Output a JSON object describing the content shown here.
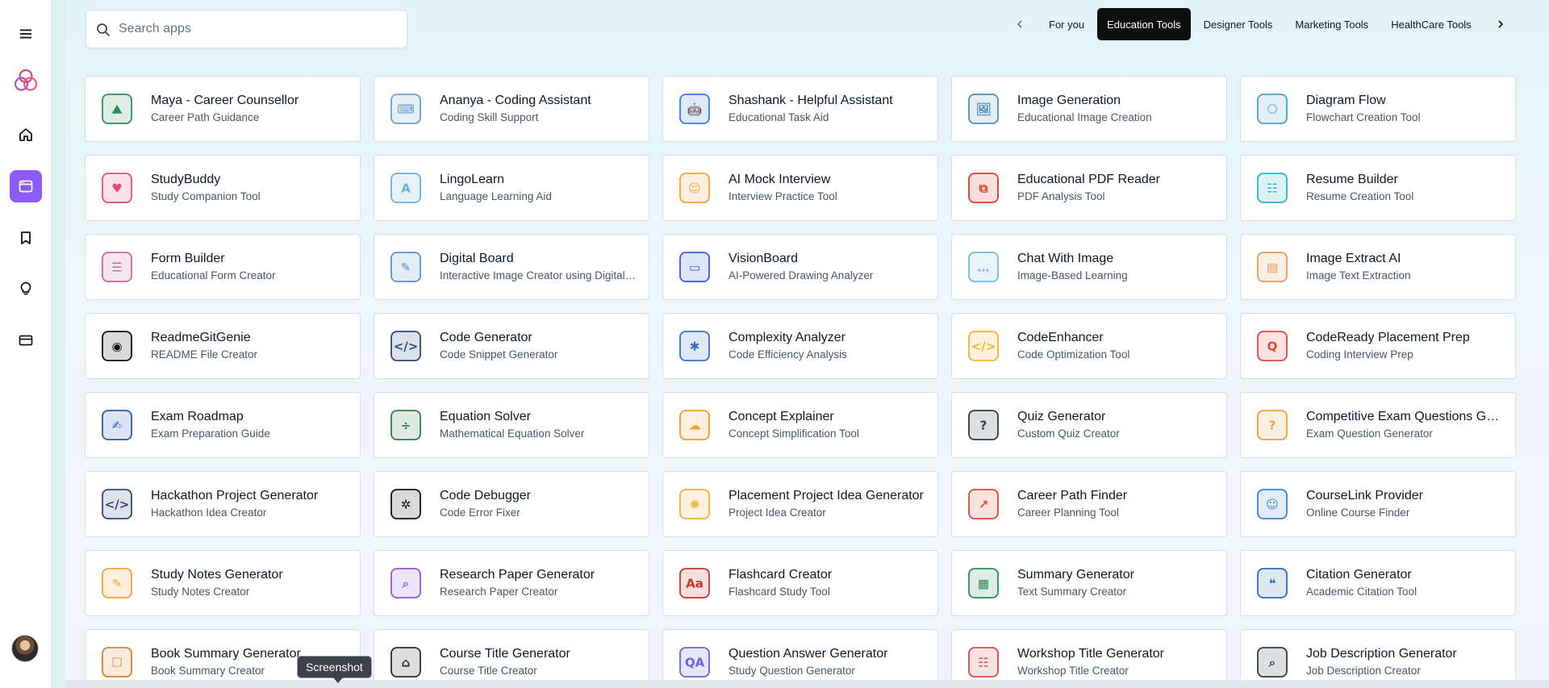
{
  "colors": {
    "accent": "#8b5cf6",
    "tab_active_bg": "#0f0f10",
    "card_border": "#d7dde3"
  },
  "sidebar": {
    "items": [
      {
        "icon": "menu-icon"
      },
      {
        "icon": "logo-icon"
      },
      {
        "icon": "home-icon"
      },
      {
        "icon": "apps-icon",
        "active": true
      },
      {
        "icon": "bookmark-icon"
      },
      {
        "icon": "lightbulb-icon"
      },
      {
        "icon": "billing-card-icon"
      }
    ],
    "avatar": "user-avatar"
  },
  "search": {
    "placeholder": "Search apps",
    "value": ""
  },
  "tabs": {
    "items": [
      {
        "label": "For you"
      },
      {
        "label": "Education Tools",
        "active": true
      },
      {
        "label": "Designer Tools"
      },
      {
        "label": "Marketing Tools"
      },
      {
        "label": "HealthCare Tools"
      }
    ]
  },
  "apps": [
    {
      "title": "Maya - Career Counsellor",
      "subtitle": "Career Path Guidance",
      "icon": "climber-icon",
      "color": "#2f8f5b"
    },
    {
      "title": "Ananya - Coding Assistant",
      "subtitle": "Coding Skill Support",
      "icon": "coding-person-icon",
      "color": "#6aa0c9"
    },
    {
      "title": "Shashank - Helpful Assistant",
      "subtitle": "Educational Task Aid",
      "icon": "robot-icon",
      "color": "#2f7fd8"
    },
    {
      "title": "Image Generation",
      "subtitle": "Educational Image Creation",
      "icon": "image-icon",
      "color": "#4a90b8"
    },
    {
      "title": "Diagram Flow",
      "subtitle": "Flowchart Creation Tool",
      "icon": "flowchart-icon",
      "color": "#4a9fd1"
    },
    {
      "title": "StudyBuddy",
      "subtitle": "Study Companion Tool",
      "icon": "buddy-icon",
      "color": "#e84a7a"
    },
    {
      "title": "LingoLearn",
      "subtitle": "Language Learning Aid",
      "icon": "translate-bubble-icon",
      "color": "#6bb0e0"
    },
    {
      "title": "AI Mock Interview",
      "subtitle": "Interview Practice Tool",
      "icon": "interview-icon",
      "color": "#f0a43a"
    },
    {
      "title": "Educational PDF Reader",
      "subtitle": "PDF Analysis Tool",
      "icon": "pdf-icon",
      "color": "#e8392b"
    },
    {
      "title": "Resume Builder",
      "subtitle": "Resume Creation Tool",
      "icon": "resume-icon",
      "color": "#27b5c9"
    },
    {
      "title": "Form Builder",
      "subtitle": "Educational Form Creator",
      "icon": "form-icon",
      "color": "#c56a9d"
    },
    {
      "title": "Digital Board",
      "subtitle": "Interactive Image Creator using Digital Board",
      "icon": "whiteboard-person-icon",
      "color": "#5b8fd0"
    },
    {
      "title": "VisionBoard",
      "subtitle": "AI-Powered Drawing Analyzer",
      "icon": "easel-icon",
      "color": "#3b5bd8"
    },
    {
      "title": "Chat With Image",
      "subtitle": "Image-Based Learning",
      "icon": "chat-bubble-icon",
      "color": "#6fb9e6"
    },
    {
      "title": "Image Extract AI",
      "subtitle": "Image Text Extraction",
      "icon": "photo-stack-icon",
      "color": "#e59a5c"
    },
    {
      "title": "ReadmeGitGenie",
      "subtitle": "README File Creator",
      "icon": "github-icon",
      "color": "#111111"
    },
    {
      "title": "Code Generator",
      "subtitle": "Code Snippet Generator",
      "icon": "monitor-code-icon",
      "color": "#2c4a7a"
    },
    {
      "title": "Complexity Analyzer",
      "subtitle": "Code Efficiency Analysis",
      "icon": "network-icon",
      "color": "#3b6ec2"
    },
    {
      "title": "CodeEnhancer",
      "subtitle": "Code Optimization Tool",
      "icon": "code-window-icon",
      "color": "#f2b134"
    },
    {
      "title": "CodeReady Placement Prep",
      "subtitle": "Coding Interview Prep",
      "icon": "qa-bubbles-icon",
      "color": "#e2483d"
    },
    {
      "title": "Exam Roadmap",
      "subtitle": "Exam Preparation Guide",
      "icon": "student-desk-icon",
      "color": "#2a5aa8"
    },
    {
      "title": "Equation Solver",
      "subtitle": "Mathematical Equation Solver",
      "icon": "chalkboard-icon",
      "color": "#2d7a4a"
    },
    {
      "title": "Concept Explainer",
      "subtitle": "Concept Simplification Tool",
      "icon": "concept-cloud-icon",
      "color": "#f29a2e"
    },
    {
      "title": "Quiz Generator",
      "subtitle": "Custom Quiz Creator",
      "icon": "quiz-icon",
      "color": "#2f3a44"
    },
    {
      "title": "Competitive Exam Questions Generator",
      "subtitle": "Exam Question Generator",
      "icon": "chat-question-icon",
      "color": "#e8a23a"
    },
    {
      "title": "Hackathon Project Generator",
      "subtitle": "Hackathon Idea Creator",
      "icon": "laptop-trophy-icon",
      "color": "#2f4a6e"
    },
    {
      "title": "Code Debugger",
      "subtitle": "Code Error Fixer",
      "icon": "bug-icon",
      "color": "#111111"
    },
    {
      "title": "Placement Project Idea Generator",
      "subtitle": "Project Idea Creator",
      "icon": "lightbulb-gear-icon",
      "color": "#f2b134"
    },
    {
      "title": "Career Path Finder",
      "subtitle": "Career Planning Tool",
      "icon": "growth-runner-icon",
      "color": "#e2483d"
    },
    {
      "title": "CourseLink Provider",
      "subtitle": "Online Course Finder",
      "icon": "desk-learner-icon",
      "color": "#3b82c4"
    },
    {
      "title": "Study Notes Generator",
      "subtitle": "Study Notes Creator",
      "icon": "sticky-note-icon",
      "color": "#f2a33a"
    },
    {
      "title": "Research Paper Generator",
      "subtitle": "Research Paper Creator",
      "icon": "research-doc-icon",
      "color": "#8a5cc9"
    },
    {
      "title": "Flashcard Creator",
      "subtitle": "Flashcard Study Tool",
      "icon": "flashcard-icon",
      "color": "#c0392b"
    },
    {
      "title": "Summary Generator",
      "subtitle": "Text Summary Creator",
      "icon": "summary-report-icon",
      "color": "#2e8b57"
    },
    {
      "title": "Citation Generator",
      "subtitle": "Academic Citation Tool",
      "icon": "citation-icon",
      "color": "#2b6cb0"
    },
    {
      "title": "Book Summary Generator",
      "subtitle": "Book Summary Creator",
      "icon": "open-book-icon",
      "color": "#d9822b"
    },
    {
      "title": "Course Title Generator",
      "subtitle": "Course Title Creator",
      "icon": "graduation-laptop-icon",
      "color": "#2b2b2b"
    },
    {
      "title": "Question Answer Generator",
      "subtitle": "Study Question Generator",
      "icon": "qa-icon",
      "color": "#6c63d8"
    },
    {
      "title": "Workshop Title Generator",
      "subtitle": "Workshop Title Creator",
      "icon": "workshop-icon",
      "color": "#d94a4a"
    },
    {
      "title": "Job Description Generator",
      "subtitle": "Job Description Creator",
      "icon": "job-search-icon",
      "color": "#2f3a44"
    }
  ],
  "tooltip": {
    "text": "Screenshot"
  }
}
